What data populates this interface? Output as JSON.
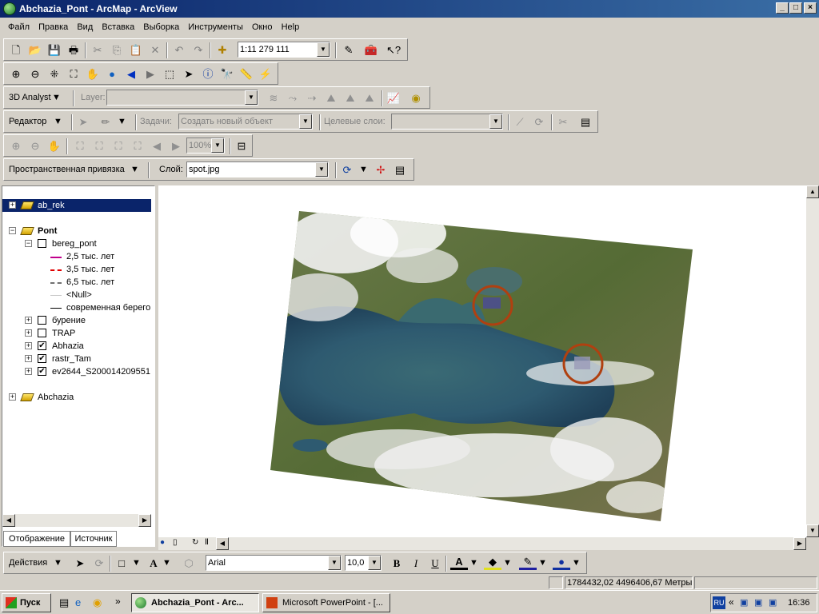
{
  "window": {
    "title": "Abchazia_Pont - ArcMap - ArcView",
    "min": "_",
    "max": "□",
    "close": "×"
  },
  "menu": [
    "Файл",
    "Правка",
    "Вид",
    "Вставка",
    "Выборка",
    "Инструменты",
    "Окно",
    "Help"
  ],
  "standard_toolbar": {
    "scale": "1:11 279 111"
  },
  "analyst_toolbar": {
    "name": "3D Analyst",
    "layer_label": "Layer:",
    "layer_value": ""
  },
  "editor_toolbar": {
    "name": "Редактор",
    "task_label": "Задачи:",
    "task_value": "Создать новый объект",
    "target_label": "Целевые слои:",
    "target_value": ""
  },
  "layout_toolbar": {
    "zoom": "100%"
  },
  "georef_toolbar": {
    "name": "Пространственная привязка",
    "layer_label": "Слой:",
    "layer_value": "spot.jpg"
  },
  "toc": {
    "items": [
      {
        "label": "ab_rek"
      },
      {
        "label": "Pont"
      },
      {
        "label": "bereg_pont"
      },
      {
        "label": "2,5 тыс. лет"
      },
      {
        "label": "3,5 тыс. лет"
      },
      {
        "label": "6,5 тыс. лет"
      },
      {
        "label": "<Null>"
      },
      {
        "label": "современная берегов"
      },
      {
        "label": "бурение"
      },
      {
        "label": "TRAP"
      },
      {
        "label": "Abhazia"
      },
      {
        "label": "rastr_Tam"
      },
      {
        "label": "ev2644_S200014209551"
      },
      {
        "label": "Abchazia"
      }
    ],
    "tab_display": "Отображение",
    "tab_source": "Источник"
  },
  "colors": {
    "sym_25": "#c0008c",
    "sym_35": "#e00000",
    "sym_65": "#707070",
    "sym_null": "#c8c8c8",
    "sym_modern": "#000000",
    "circle": "#b04010"
  },
  "draw_toolbar": {
    "actions": "Действия",
    "font": "Arial",
    "font_size": "10,0",
    "bold": "B",
    "italic": "I",
    "underline": "U",
    "text_tool": "A"
  },
  "status": {
    "coords": "1784432,02  4496406,67 Метры"
  },
  "taskbar": {
    "start": "Пуск",
    "tasks": [
      "Abchazia_Pont - Arc...",
      "Microsoft PowerPoint - [..."
    ],
    "lang": "RU",
    "clock": "16:36"
  }
}
